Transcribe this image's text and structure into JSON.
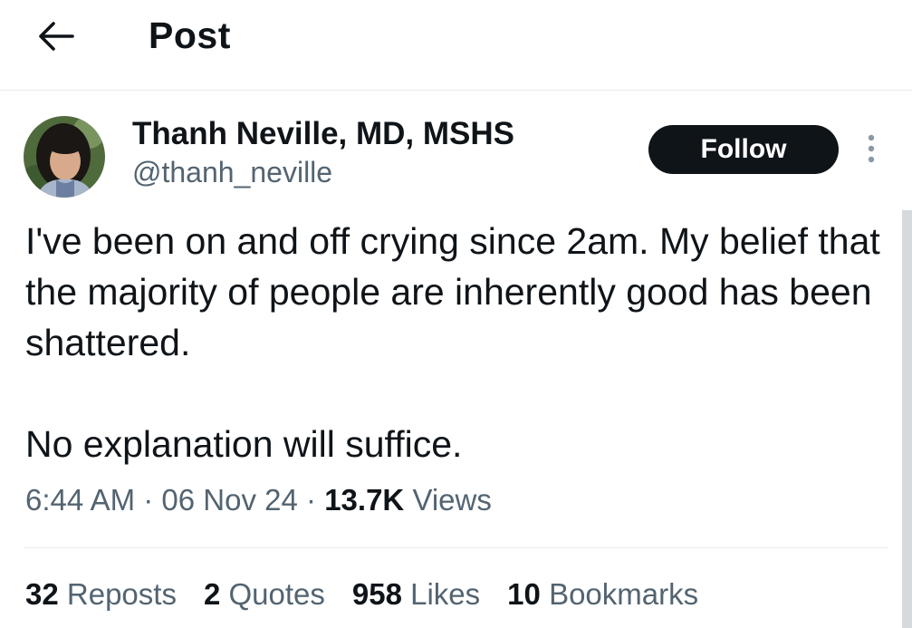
{
  "header": {
    "back_icon": "arrow-left-icon",
    "title": "Post"
  },
  "author": {
    "name": "Thanh Neville, MD, MSHS",
    "handle": "@thanh_neville",
    "follow_label": "Follow",
    "more_icon": "more-vertical-icon"
  },
  "post": {
    "text": "I've been on and off crying since 2am. My belief that the majority of people are inherently good has been shattered.\n\nNo explanation will suffice.",
    "time": "6:44 AM",
    "date": "06 Nov 24",
    "views_count": "13.7K",
    "views_label": "Views",
    "separator": "·"
  },
  "stats": [
    {
      "count": "32",
      "label": "Reposts"
    },
    {
      "count": "2",
      "label": "Quotes"
    },
    {
      "count": "958",
      "label": "Likes"
    },
    {
      "count": "10",
      "label": "Bookmarks"
    }
  ],
  "colors": {
    "text_primary": "#0f1419",
    "text_secondary": "#536471",
    "follow_bg": "#0f1419",
    "divider": "#e6e9eb"
  }
}
